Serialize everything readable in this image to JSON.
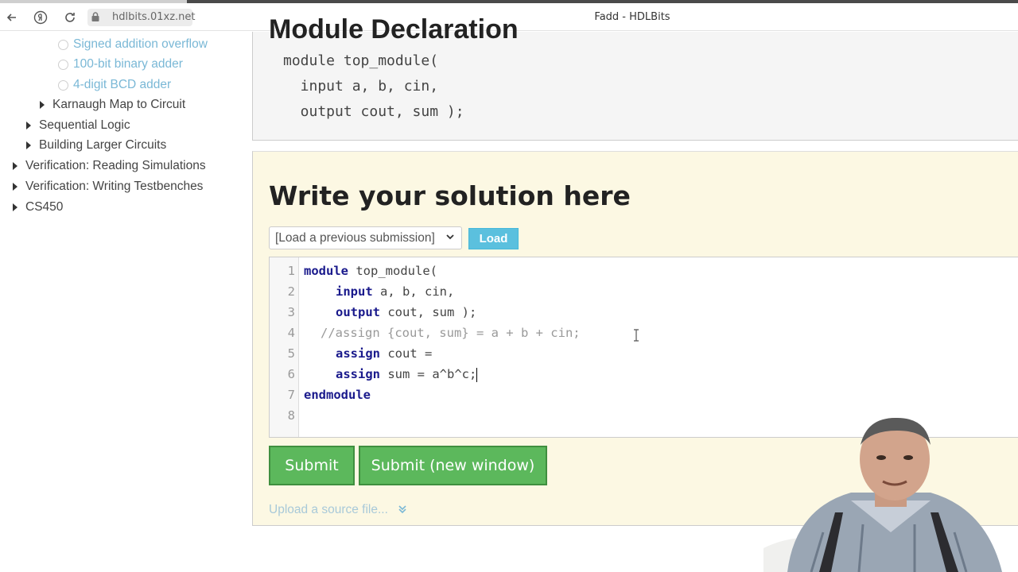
{
  "browser": {
    "url": "hdlbits.01xz.net",
    "tab_title": "Fadd - HDLBits"
  },
  "sidebar": {
    "items": [
      {
        "label": "Signed addition overflow",
        "kind": "sub"
      },
      {
        "label": "100-bit binary adder",
        "kind": "sub"
      },
      {
        "label": "4-digit BCD adder",
        "kind": "sub"
      },
      {
        "label": "Karnaugh Map to Circuit",
        "kind": "cat"
      },
      {
        "label": "Sequential Logic",
        "kind": "cat"
      },
      {
        "label": "Building Larger Circuits",
        "kind": "cat"
      },
      {
        "label": "Verification: Reading Simulations",
        "kind": "cat"
      },
      {
        "label": "Verification: Writing Testbenches",
        "kind": "cat"
      },
      {
        "label": "CS450",
        "kind": "cat"
      }
    ]
  },
  "declaration": {
    "heading": "Module Declaration",
    "lines": [
      "module top_module(",
      "  input a, b, cin,",
      "  output cout, sum );"
    ]
  },
  "solution": {
    "title": "Write your solution here",
    "select_value": "[Load a previous submission]",
    "load_label": "Load",
    "line_numbers": [
      "1",
      "2",
      "3",
      "4",
      "5",
      "6",
      "7",
      "8"
    ],
    "code": {
      "l1_kw": "module",
      "l1_rest": " top_module(",
      "l2_kw": "input",
      "l2_rest": " a, b, cin,",
      "l3_kw": "output",
      "l3_rest": " cout, sum );",
      "l4_comment": "//assign {cout, sum} = a + b + cin;",
      "l5_kw": "assign",
      "l5_rest": " cout =",
      "l6_kw": "assign",
      "l6_rest": " sum = a^b^c;",
      "l7_kw": "endmodule"
    },
    "submit_label": "Submit",
    "submit_new_label": "Submit (new window)",
    "upload_label": "Upload a source file..."
  },
  "colors": {
    "accent_link": "#7ab8d6",
    "submit_green": "#5cb85c",
    "load_blue": "#5bc0de",
    "solution_bg": "#fcf8e3",
    "keyword": "#1a1a8c"
  }
}
